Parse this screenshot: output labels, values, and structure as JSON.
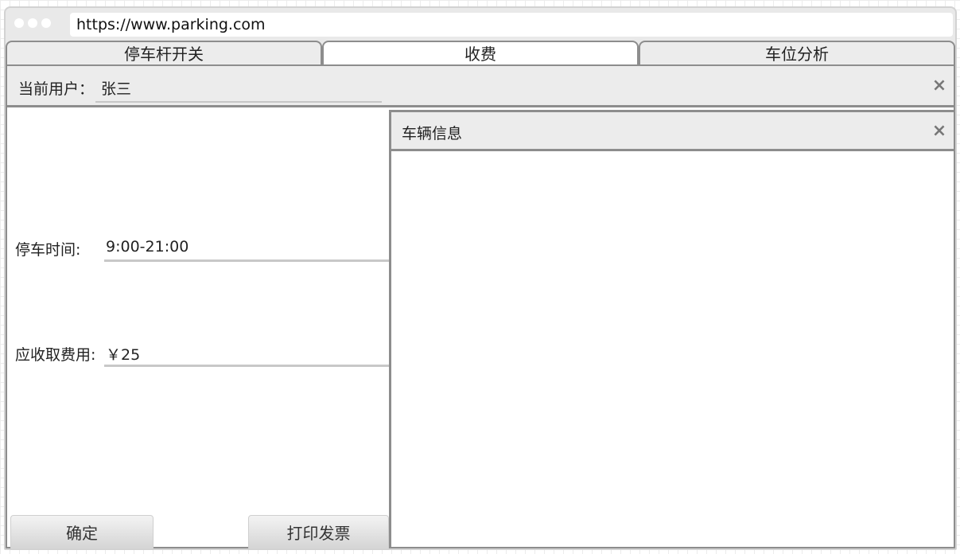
{
  "browser": {
    "url": "https://www.parking.com"
  },
  "tabs": [
    {
      "label": "停车杆开关",
      "active": false
    },
    {
      "label": "收费",
      "active": true
    },
    {
      "label": "车位分析",
      "active": false
    }
  ],
  "user_bar": {
    "label": "当前用户：",
    "name": "张三",
    "close_icon": "×"
  },
  "form": {
    "parking_time_label": "停车时间:",
    "parking_time_value": "9:00-21:00",
    "fee_label": "应收取费用:",
    "fee_value": "￥25"
  },
  "buttons": {
    "ok_label": "确定",
    "print_label": "打印发票"
  },
  "vehicle_panel": {
    "title": "车辆信息",
    "close_icon": "×"
  },
  "colors": {
    "tab_border": "#8d8d8d",
    "panel_bg": "#ececec"
  }
}
